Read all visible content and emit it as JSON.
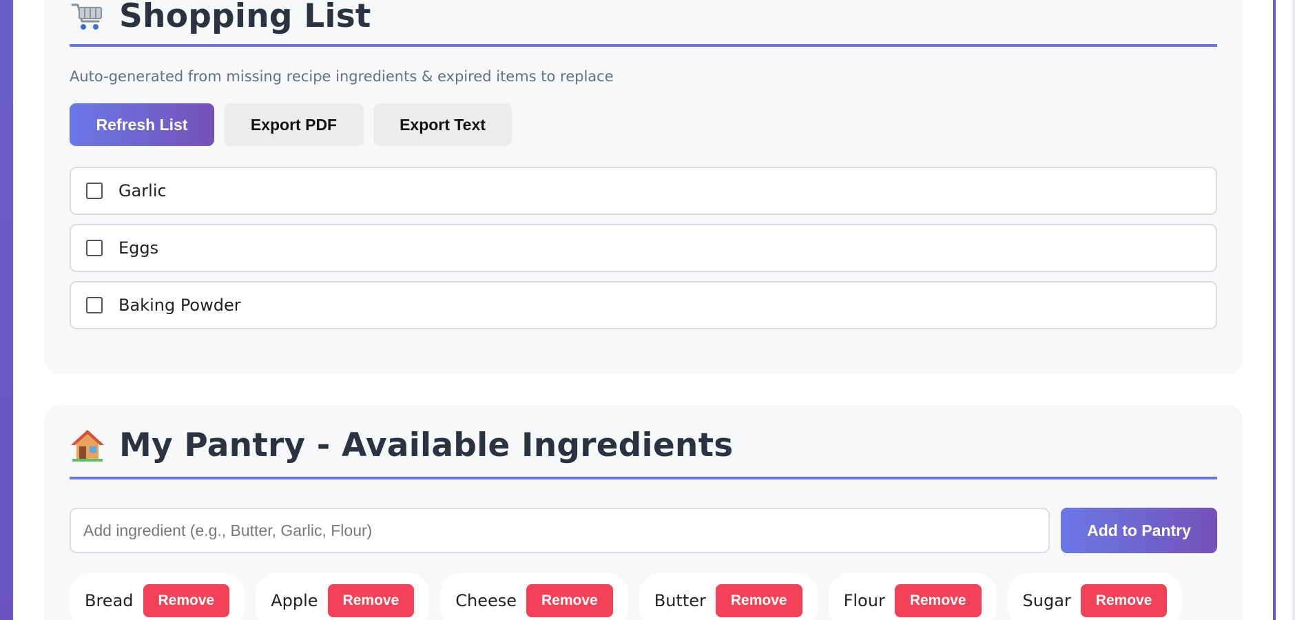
{
  "shopping": {
    "title": "Shopping List",
    "subtitle": "Auto-generated from missing recipe ingredients & expired items to replace",
    "buttons": {
      "refresh": "Refresh List",
      "export_pdf": "Export PDF",
      "export_text": "Export Text"
    },
    "items": [
      {
        "label": "Garlic",
        "checked": false
      },
      {
        "label": "Eggs",
        "checked": false
      },
      {
        "label": "Baking Powder",
        "checked": false
      }
    ],
    "icon": "shopping-cart-icon"
  },
  "pantry": {
    "title": "My Pantry - Available Ingredients",
    "icon": "house-icon",
    "input_placeholder": "Add ingredient (e.g., Butter, Garlic, Flour)",
    "add_button": "Add to Pantry",
    "remove_label": "Remove",
    "ingredients": [
      "Bread",
      "Apple",
      "Cheese",
      "Butter",
      "Flour",
      "Sugar"
    ]
  },
  "colors": {
    "accent_gradient_start": "#6a78e6",
    "accent_gradient_end": "#7551b8",
    "danger": "#f24257",
    "title_underline": "#6976e0",
    "background_purple": "#6b5fc6"
  }
}
